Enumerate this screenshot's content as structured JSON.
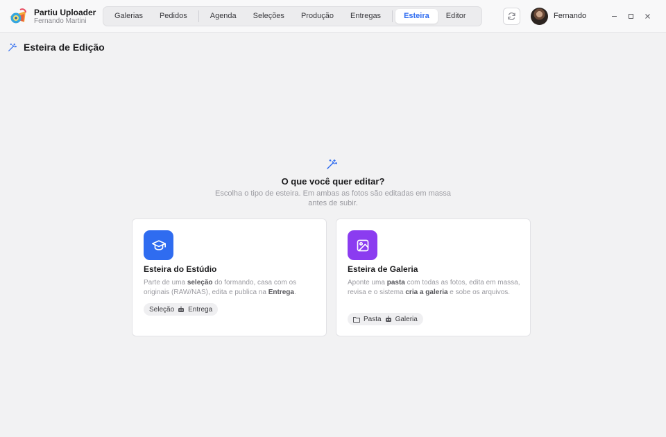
{
  "app": {
    "title": "Partiu Uploader",
    "subtitle": "Fernando Martini"
  },
  "nav": {
    "items": [
      {
        "label": "Galerias"
      },
      {
        "label": "Pedidos"
      },
      {
        "label": "Agenda"
      },
      {
        "label": "Seleções"
      },
      {
        "label": "Produção"
      },
      {
        "label": "Entregas"
      },
      {
        "label": "Esteira",
        "active": true
      },
      {
        "label": "Editor"
      }
    ]
  },
  "user": {
    "name": "Fernando"
  },
  "page": {
    "title": "Esteira de Edição",
    "icon": "magic-wand-icon"
  },
  "hero": {
    "icon": "magic-wand-icon",
    "title": "O que você quer editar?",
    "description": "Escolha o tipo de esteira. Em ambas as fotos são editadas em massa antes de subir."
  },
  "cards": [
    {
      "icon": "graduation-cap-icon",
      "icon_bg": "#2f6cf0",
      "title": "Esteira do Estúdio",
      "desc": [
        {
          "text": "Parte de uma "
        },
        {
          "text": "seleção",
          "bold": true
        },
        {
          "text": " do formando, casa com os originais (RAW/NAS), edita e publica na "
        },
        {
          "text": "Entrega",
          "bold": true
        },
        {
          "text": "."
        }
      ],
      "pill": {
        "from": "Seleção",
        "to": "Entrega",
        "lead_icon": ""
      }
    },
    {
      "icon": "image-icon",
      "icon_bg": "#8b3cf0",
      "title": "Esteira de Galeria",
      "desc": [
        {
          "text": "Aponte uma "
        },
        {
          "text": "pasta",
          "bold": true
        },
        {
          "text": " com todas as fotos, edita em massa, revisa e o sistema "
        },
        {
          "text": "cria a galeria",
          "bold": true
        },
        {
          "text": " e sobe os arquivos."
        }
      ],
      "pill": {
        "from": "Pasta",
        "to": "Galeria",
        "lead_icon": "folder-icon"
      }
    }
  ],
  "colors": {
    "accent": "#2f6cf0",
    "studio": "#2f6cf0",
    "gallery": "#8b3cf0"
  }
}
